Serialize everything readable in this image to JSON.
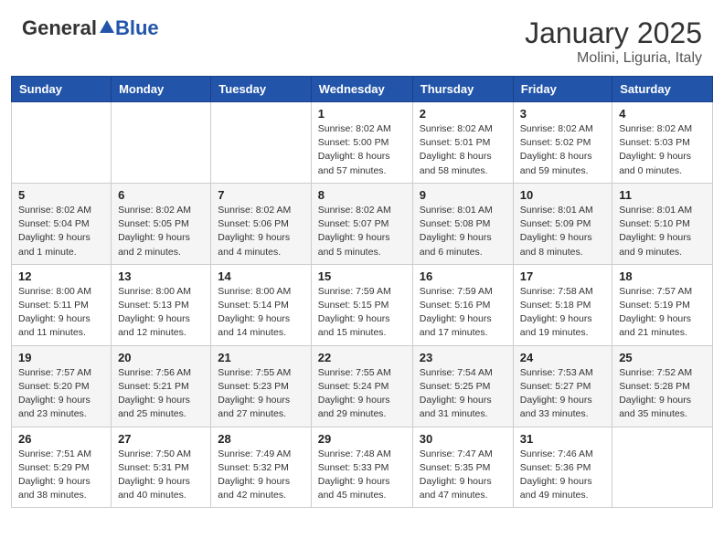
{
  "header": {
    "logo_general": "General",
    "logo_blue": "Blue",
    "month": "January 2025",
    "location": "Molini, Liguria, Italy"
  },
  "days_of_week": [
    "Sunday",
    "Monday",
    "Tuesday",
    "Wednesday",
    "Thursday",
    "Friday",
    "Saturday"
  ],
  "weeks": [
    [
      {
        "day": "",
        "info": ""
      },
      {
        "day": "",
        "info": ""
      },
      {
        "day": "",
        "info": ""
      },
      {
        "day": "1",
        "info": "Sunrise: 8:02 AM\nSunset: 5:00 PM\nDaylight: 8 hours and 57 minutes."
      },
      {
        "day": "2",
        "info": "Sunrise: 8:02 AM\nSunset: 5:01 PM\nDaylight: 8 hours and 58 minutes."
      },
      {
        "day": "3",
        "info": "Sunrise: 8:02 AM\nSunset: 5:02 PM\nDaylight: 8 hours and 59 minutes."
      },
      {
        "day": "4",
        "info": "Sunrise: 8:02 AM\nSunset: 5:03 PM\nDaylight: 9 hours and 0 minutes."
      }
    ],
    [
      {
        "day": "5",
        "info": "Sunrise: 8:02 AM\nSunset: 5:04 PM\nDaylight: 9 hours and 1 minute."
      },
      {
        "day": "6",
        "info": "Sunrise: 8:02 AM\nSunset: 5:05 PM\nDaylight: 9 hours and 2 minutes."
      },
      {
        "day": "7",
        "info": "Sunrise: 8:02 AM\nSunset: 5:06 PM\nDaylight: 9 hours and 4 minutes."
      },
      {
        "day": "8",
        "info": "Sunrise: 8:02 AM\nSunset: 5:07 PM\nDaylight: 9 hours and 5 minutes."
      },
      {
        "day": "9",
        "info": "Sunrise: 8:01 AM\nSunset: 5:08 PM\nDaylight: 9 hours and 6 minutes."
      },
      {
        "day": "10",
        "info": "Sunrise: 8:01 AM\nSunset: 5:09 PM\nDaylight: 9 hours and 8 minutes."
      },
      {
        "day": "11",
        "info": "Sunrise: 8:01 AM\nSunset: 5:10 PM\nDaylight: 9 hours and 9 minutes."
      }
    ],
    [
      {
        "day": "12",
        "info": "Sunrise: 8:00 AM\nSunset: 5:11 PM\nDaylight: 9 hours and 11 minutes."
      },
      {
        "day": "13",
        "info": "Sunrise: 8:00 AM\nSunset: 5:13 PM\nDaylight: 9 hours and 12 minutes."
      },
      {
        "day": "14",
        "info": "Sunrise: 8:00 AM\nSunset: 5:14 PM\nDaylight: 9 hours and 14 minutes."
      },
      {
        "day": "15",
        "info": "Sunrise: 7:59 AM\nSunset: 5:15 PM\nDaylight: 9 hours and 15 minutes."
      },
      {
        "day": "16",
        "info": "Sunrise: 7:59 AM\nSunset: 5:16 PM\nDaylight: 9 hours and 17 minutes."
      },
      {
        "day": "17",
        "info": "Sunrise: 7:58 AM\nSunset: 5:18 PM\nDaylight: 9 hours and 19 minutes."
      },
      {
        "day": "18",
        "info": "Sunrise: 7:57 AM\nSunset: 5:19 PM\nDaylight: 9 hours and 21 minutes."
      }
    ],
    [
      {
        "day": "19",
        "info": "Sunrise: 7:57 AM\nSunset: 5:20 PM\nDaylight: 9 hours and 23 minutes."
      },
      {
        "day": "20",
        "info": "Sunrise: 7:56 AM\nSunset: 5:21 PM\nDaylight: 9 hours and 25 minutes."
      },
      {
        "day": "21",
        "info": "Sunrise: 7:55 AM\nSunset: 5:23 PM\nDaylight: 9 hours and 27 minutes."
      },
      {
        "day": "22",
        "info": "Sunrise: 7:55 AM\nSunset: 5:24 PM\nDaylight: 9 hours and 29 minutes."
      },
      {
        "day": "23",
        "info": "Sunrise: 7:54 AM\nSunset: 5:25 PM\nDaylight: 9 hours and 31 minutes."
      },
      {
        "day": "24",
        "info": "Sunrise: 7:53 AM\nSunset: 5:27 PM\nDaylight: 9 hours and 33 minutes."
      },
      {
        "day": "25",
        "info": "Sunrise: 7:52 AM\nSunset: 5:28 PM\nDaylight: 9 hours and 35 minutes."
      }
    ],
    [
      {
        "day": "26",
        "info": "Sunrise: 7:51 AM\nSunset: 5:29 PM\nDaylight: 9 hours and 38 minutes."
      },
      {
        "day": "27",
        "info": "Sunrise: 7:50 AM\nSunset: 5:31 PM\nDaylight: 9 hours and 40 minutes."
      },
      {
        "day": "28",
        "info": "Sunrise: 7:49 AM\nSunset: 5:32 PM\nDaylight: 9 hours and 42 minutes."
      },
      {
        "day": "29",
        "info": "Sunrise: 7:48 AM\nSunset: 5:33 PM\nDaylight: 9 hours and 45 minutes."
      },
      {
        "day": "30",
        "info": "Sunrise: 7:47 AM\nSunset: 5:35 PM\nDaylight: 9 hours and 47 minutes."
      },
      {
        "day": "31",
        "info": "Sunrise: 7:46 AM\nSunset: 5:36 PM\nDaylight: 9 hours and 49 minutes."
      },
      {
        "day": "",
        "info": ""
      }
    ]
  ]
}
